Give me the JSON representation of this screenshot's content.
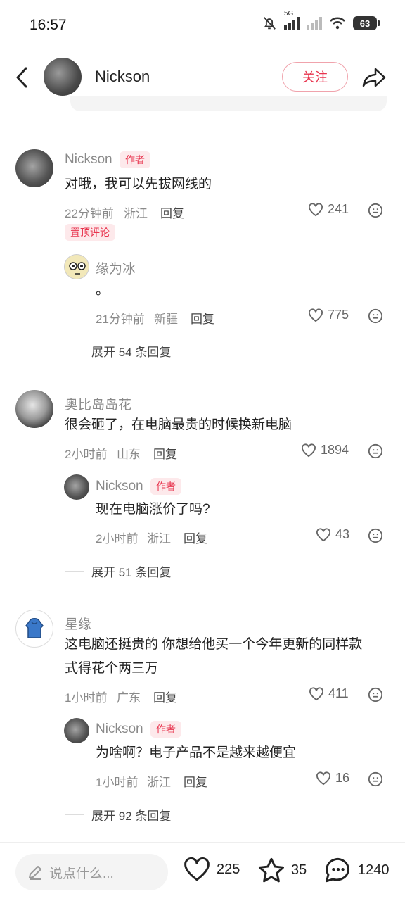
{
  "status_bar": {
    "time": "16:57",
    "network": "5G",
    "battery": "63"
  },
  "header": {
    "username": "Nickson",
    "follow_label": "关注"
  },
  "comments": [
    {
      "username": "Nickson",
      "author_tag": "作者",
      "text": "对哦，我可以先拔网线的",
      "time": "22分钟前",
      "location": "浙江",
      "reply": "回复",
      "likes": "241",
      "pinned": "置顶评论",
      "replies": [
        {
          "username": "缘为冰",
          "text": "。",
          "time": "21分钟前",
          "location": "新疆",
          "reply": "回复",
          "likes": "775"
        }
      ],
      "expand": "展开 54 条回复"
    },
    {
      "username": "奥比岛岛花",
      "text": "很会砸了，在电脑最贵的时候换新电脑",
      "time": "2小时前",
      "location": "山东",
      "reply": "回复",
      "likes": "1894",
      "replies": [
        {
          "username": "Nickson",
          "author_tag": "作者",
          "text": "现在电脑涨价了吗?",
          "time": "2小时前",
          "location": "浙江",
          "reply": "回复",
          "likes": "43"
        }
      ],
      "expand": "展开 51 条回复"
    },
    {
      "username": "星缘",
      "text_line1": "这电脑还挺贵的 你想给他买一个今年更新的同样款",
      "text_line2": "式得花个两三万",
      "time": "1小时前",
      "location": "广东",
      "reply": "回复",
      "likes": "411",
      "replies": [
        {
          "username": "Nickson",
          "author_tag": "作者",
          "text": "为啥啊？电子产品不是越来越便宜",
          "time": "1小时前",
          "location": "浙江",
          "reply": "回复",
          "likes": "16"
        }
      ],
      "expand": "展开 92 条回复"
    }
  ],
  "bottom_bar": {
    "input_placeholder": "说点什么...",
    "likes": "225",
    "stars": "35",
    "comments": "1240"
  },
  "colors": {
    "accent": "#e8344e",
    "tag_bg": "#fde9eb",
    "meta": "#8a8a8a"
  }
}
